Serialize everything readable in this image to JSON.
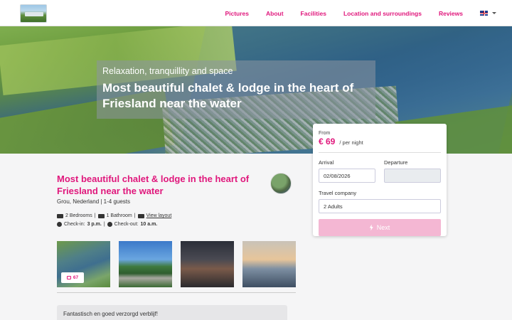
{
  "nav": {
    "links": [
      "Pictures",
      "About",
      "Facilities",
      "Location and surroundings",
      "Reviews"
    ],
    "language_icon": "uk-flag-icon"
  },
  "hero": {
    "subtitle": "Relaxation, tranquillity and space",
    "title": "Most beautiful chalet & lodge in the heart of Friesland near the water"
  },
  "booking": {
    "from_label": "From",
    "price": "€ 69",
    "per_night": "/ per night",
    "arrival_label": "Arrival",
    "arrival_value": "02/08/2026",
    "departure_label": "Departure",
    "departure_value": "",
    "company_label": "Travel company",
    "company_value": "2 Adults",
    "next_label": "Next",
    "next_icon": "lightning-bolt-icon"
  },
  "listing": {
    "title": "Most beautiful chalet & lodge in the heart of Friesland near the water",
    "location": "Grou, Nederland | 1-4 guests",
    "bedrooms": "2 Bedrooms",
    "bathroom": "1 Bathroom",
    "layout_link": "View layout",
    "checkin_label": "Check-in:",
    "checkin_time": "3 p.m.",
    "checkout_label": "Check-out:",
    "checkout_time": "10 a.m.",
    "photo_count": "67"
  },
  "review": {
    "text": "Fantastisch en goed verzorgd verblijf!"
  },
  "colors": {
    "accent": "#e0177c",
    "button_disabled": "#f4b7d3"
  }
}
